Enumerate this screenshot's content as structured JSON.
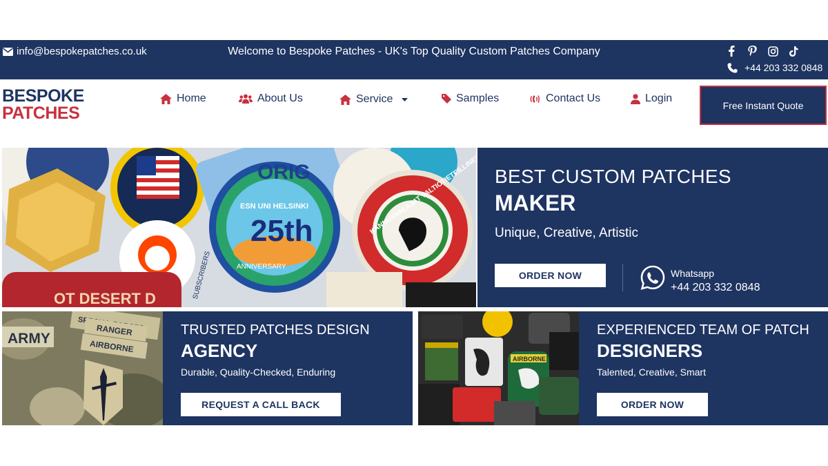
{
  "topbar": {
    "email": "info@bespokepatches.co.uk",
    "welcome": "Welcome to Bespoke Patches - UK's Top Quality Custom Patches Company",
    "phone": "+44 203 332 0848",
    "social_icons": [
      "facebook-icon",
      "pinterest-icon",
      "instagram-icon",
      "tiktok-icon"
    ]
  },
  "logo": {
    "line1": "BESPOKE",
    "line2": "PATCHES"
  },
  "nav": {
    "home": "Home",
    "about": "About Us",
    "service": "Service",
    "samples": "Samples",
    "contact": "Contact Us",
    "login": "Login",
    "quote": "Free Instant Quote"
  },
  "hero": {
    "line1": "BEST CUSTOM PATCHES",
    "line2": "MAKER",
    "tagline": "Unique, Creative, Artistic",
    "cta": "ORDER NOW",
    "whatsapp_label": "Whatsapp",
    "whatsapp_phone": "+44 203 332 0848",
    "patch_texts": [
      "ESN UNI HELSINKI",
      "25th",
      "ANNIVERSARY",
      "KANNUNVALAJAT VALTIOTIETEILLINEN TDK",
      "ORIG",
      "SUBSCRIBERS",
      "OT DESERT D"
    ]
  },
  "card1": {
    "line1": "TRUSTED PATCHES DESIGN",
    "line2": "AGENCY",
    "tagline": "Durable, Quality-Checked, Enduring",
    "cta": "REQUEST A CALL BACK",
    "patch_texts": [
      "ARMY",
      "SPECIAL FORCES",
      "RANGER",
      "AIRBORNE"
    ]
  },
  "card2": {
    "line1": "EXPERIENCED TEAM OF PATCH",
    "line2": "DESIGNERS",
    "tagline": "Talented, Creative, Smart",
    "cta": "ORDER NOW",
    "patch_texts": [
      "AIRBORNE"
    ]
  },
  "colors": {
    "navy": "#1e3461",
    "red": "#c8313f",
    "white": "#ffffff"
  }
}
